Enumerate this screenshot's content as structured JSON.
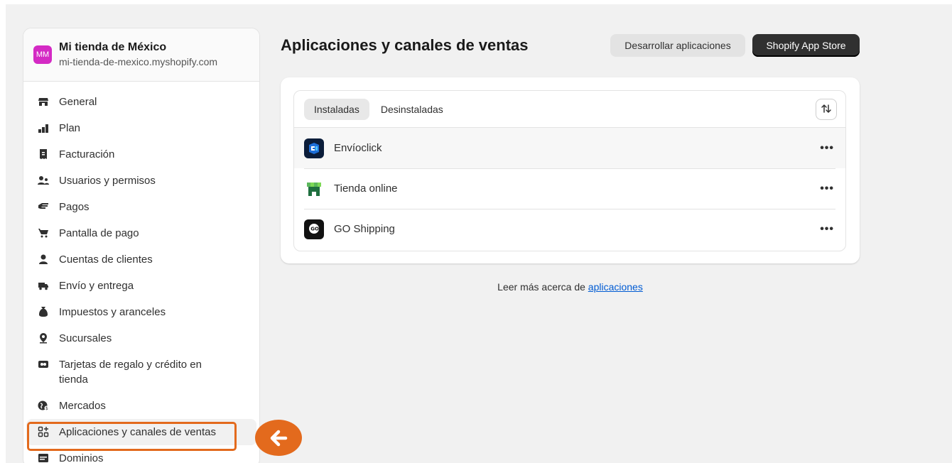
{
  "store": {
    "avatar": "MM",
    "name": "Mi tienda de México",
    "url": "mi-tienda-de-mexico.myshopify.com"
  },
  "nav": [
    {
      "label": "General",
      "icon": "store-icon"
    },
    {
      "label": "Plan",
      "icon": "plan-icon"
    },
    {
      "label": "Facturación",
      "icon": "receipt-icon"
    },
    {
      "label": "Usuarios y permisos",
      "icon": "users-icon"
    },
    {
      "label": "Pagos",
      "icon": "payment-icon"
    },
    {
      "label": "Pantalla de pago",
      "icon": "cart-icon"
    },
    {
      "label": "Cuentas de clientes",
      "icon": "person-icon"
    },
    {
      "label": "Envío y entrega",
      "icon": "truck-icon"
    },
    {
      "label": "Impuestos y aranceles",
      "icon": "tax-icon"
    },
    {
      "label": "Sucursales",
      "icon": "location-icon"
    },
    {
      "label": "Tarjetas de regalo y crédito en tienda",
      "icon": "gift-card-icon"
    },
    {
      "label": "Mercados",
      "icon": "globe-icon"
    },
    {
      "label": "Aplicaciones y canales de ventas",
      "icon": "apps-icon"
    },
    {
      "label": "Dominios",
      "icon": "domain-icon"
    }
  ],
  "main": {
    "title": "Aplicaciones y canales de ventas",
    "develop_button": "Desarrollar aplicaciones",
    "appstore_button": "Shopify App Store",
    "tabs": [
      {
        "label": "Instaladas"
      },
      {
        "label": "Desinstaladas"
      }
    ],
    "apps": [
      {
        "name": "Envíoclick",
        "icon": "envioclick-icon"
      },
      {
        "name": "Tienda online",
        "icon": "online-store-icon"
      },
      {
        "name": "GO Shipping",
        "icon": "go-shipping-icon",
        "icon_text": "GO"
      }
    ],
    "more_menu": "•••",
    "learn_prefix": "Leer más acerca de ",
    "learn_link": "aplicaciones"
  },
  "colors": {
    "highlight": "#e36a1d",
    "avatar": "#d42ac4",
    "link": "#005bd3"
  }
}
